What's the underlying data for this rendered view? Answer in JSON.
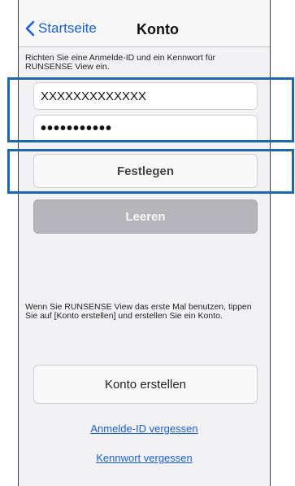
{
  "nav": {
    "back_label": "Startseite",
    "title": "Konto"
  },
  "instructions": "Richten Sie eine Anmelde-ID und ein Kennwort für RUNSENSE View ein.",
  "login": {
    "id_value": "XXXXXXXXXXXXX",
    "password_value": "•••••••••••"
  },
  "buttons": {
    "set": "Festlegen",
    "clear": "Leeren",
    "create_account": "Konto erstellen"
  },
  "note": "Wenn Sie RUNSENSE View das erste Mal benutzen, tippen Sie auf [Konto erstellen] und erstellen Sie ein Konto.",
  "links": {
    "forgot_id": "Anmelde-ID vergessen",
    "forgot_password": "Kennwort vergessen"
  },
  "colors": {
    "accent": "#1a5fd0",
    "highlight": "#1e66ad"
  }
}
